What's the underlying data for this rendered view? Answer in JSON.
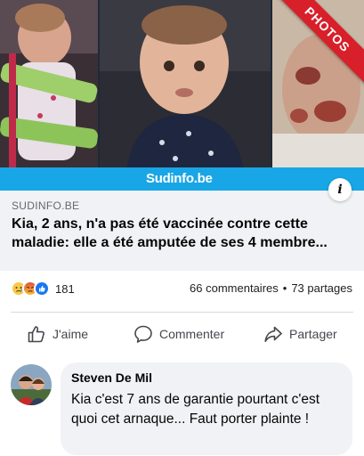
{
  "image_badge": "PHOTOS",
  "brand_logo": "Sudinfo.be",
  "link_preview": {
    "source": "SUDINFO.BE",
    "headline": "Kia, 2 ans, n'a pas été vaccinée contre cette maladie: elle a été amputée de ses 4 membre...",
    "info_icon": "i"
  },
  "reactions": {
    "icons": [
      "sad-reaction-icon",
      "angry-reaction-icon",
      "like-reaction-icon"
    ],
    "count": "181"
  },
  "stats": {
    "comments": "66 commentaires",
    "separator": "•",
    "shares": "73 partages"
  },
  "actions": {
    "like": "J'aime",
    "comment": "Commenter",
    "share": "Partager"
  },
  "comment": {
    "author": "Steven De Mil",
    "text": "Kia c'est 7 ans de garantie pourtant c'est quoi cet arnaque... Faut porter plainte !"
  },
  "colors": {
    "brand_blue": "#19a6e6",
    "badge_red": "#d8202a",
    "like_blue": "#1877f2",
    "bubble_gray": "#f0f2f5"
  }
}
